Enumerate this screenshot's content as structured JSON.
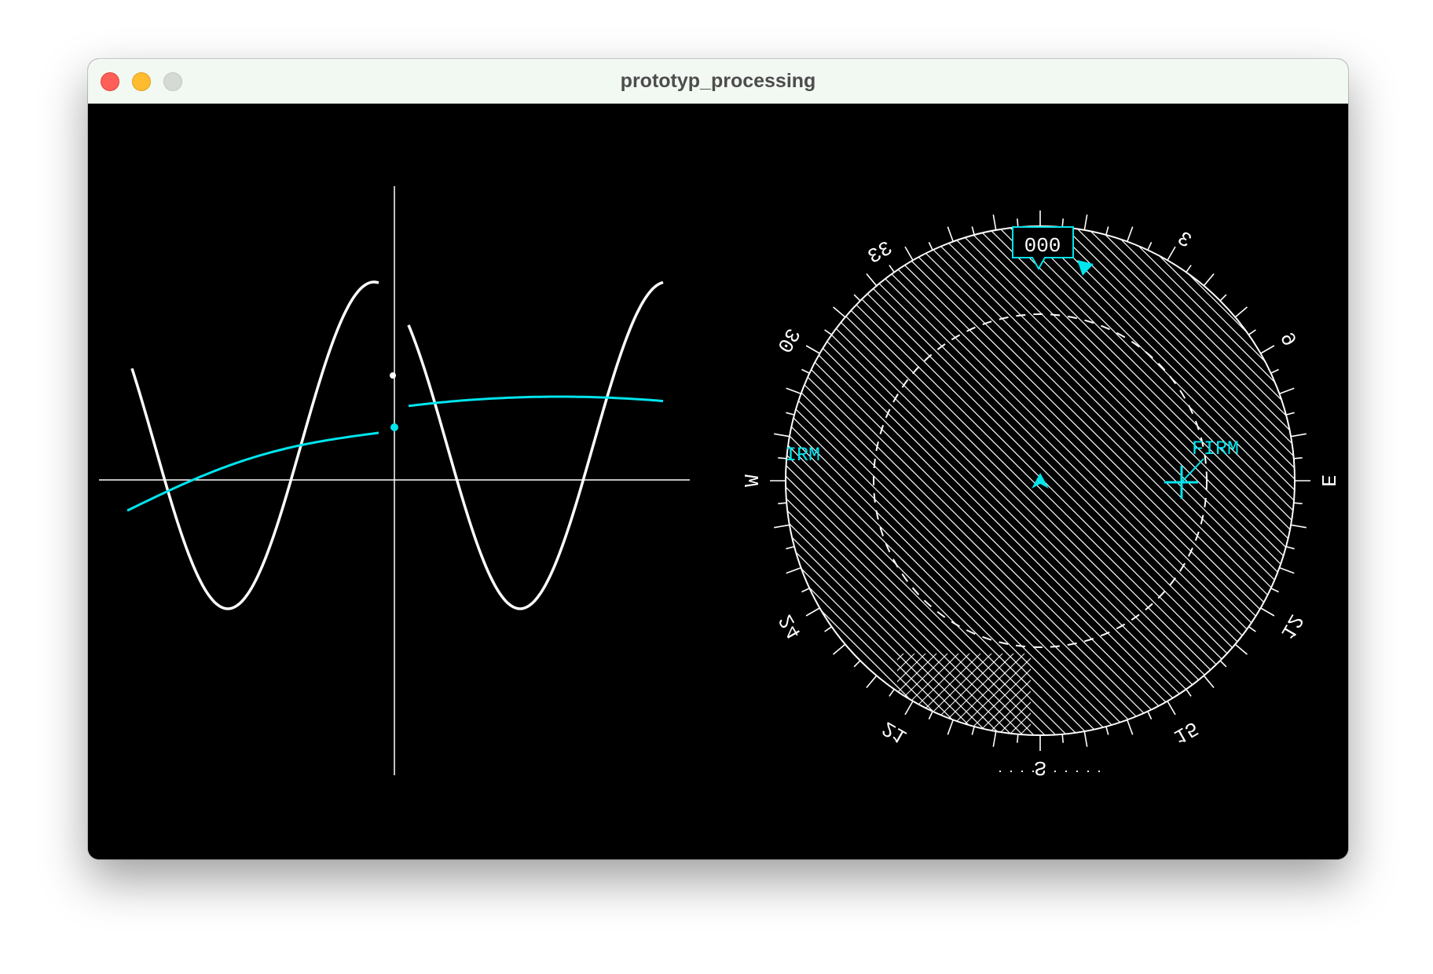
{
  "window": {
    "title": "prototyp_processing"
  },
  "compass": {
    "heading_box": "000",
    "labels": [
      "33",
      "30",
      "W",
      "24",
      "21",
      "S",
      "15",
      "12",
      "E",
      "6",
      "3"
    ],
    "nav_left": "IRM",
    "nav_right": "FIRM"
  },
  "colors": {
    "cyan": "#00e5ee",
    "white": "#ffffff",
    "background": "#000000"
  },
  "icons": [
    "heading-bug-icon",
    "aircraft-icon",
    "waypoint-cross-icon"
  ]
}
